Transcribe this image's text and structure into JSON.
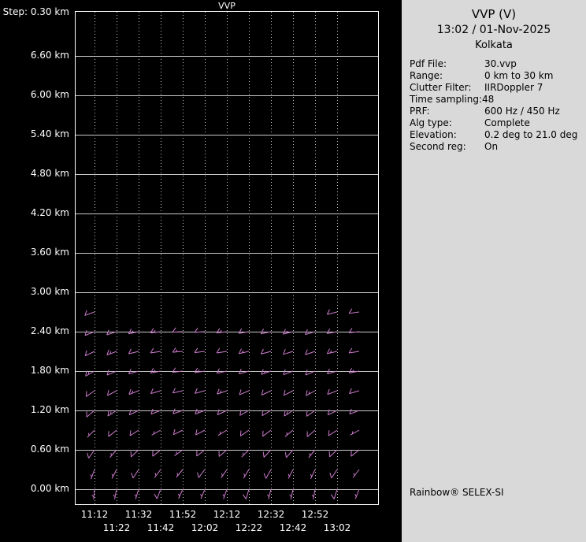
{
  "colors": {
    "background": "#000000",
    "plot_text": "#ffffff",
    "grid": "#c8c8c8",
    "border": "#ffffff",
    "barb": "#cc7ccc",
    "panel_bg": "#d9d9d9",
    "panel_text": "#000000"
  },
  "chart_data": {
    "type": "wind_barbs",
    "title": "VVP",
    "step_label": "Step: 0.30 km",
    "x_tick_labels": [
      "11:12",
      "11:22",
      "11:32",
      "11:42",
      "11:52",
      "12:02",
      "12:12",
      "12:22",
      "12:32",
      "12:42",
      "12:52",
      "13:02"
    ],
    "x_tick_interval_min": 10,
    "y_tick_km": [
      6.6,
      6.0,
      5.4,
      4.8,
      4.2,
      3.6,
      3.0,
      2.4,
      1.8,
      1.2,
      0.6,
      0.0
    ],
    "y_tick_labels": [
      "6.60 km",
      "6.00 km",
      "5.40 km",
      "4.80 km",
      "4.20 km",
      "3.60 km",
      "3.00 km",
      "2.40 km",
      "1.80 km",
      "1.20 km",
      "0.60 km",
      "0.00 km"
    ],
    "y_step_km": 0.3,
    "barbs": [
      {
        "h_km": 2.7,
        "cols": [
          0,
          11,
          12
        ],
        "dir_deg": [
          250,
          256,
          262
        ],
        "spd_kt": [
          10,
          10,
          10
        ]
      },
      {
        "h_km": 2.4,
        "cols": [
          0,
          1,
          2,
          3,
          4,
          5,
          6,
          7,
          8,
          9,
          10,
          11,
          12
        ],
        "dir_deg": [
          248,
          252,
          258,
          263,
          268,
          266,
          263,
          260,
          258,
          256,
          254,
          259,
          264
        ],
        "spd_kt": [
          10,
          10,
          15,
          15,
          10,
          10,
          15,
          10,
          10,
          15,
          10,
          10,
          10
        ]
      },
      {
        "h_km": 2.1,
        "cols": [
          0,
          1,
          2,
          3,
          4,
          5,
          6,
          7,
          8,
          9,
          10,
          11,
          12
        ],
        "dir_deg": [
          244,
          249,
          256,
          261,
          265,
          263,
          261,
          257,
          255,
          253,
          251,
          257,
          261
        ],
        "spd_kt": [
          10,
          15,
          10,
          10,
          15,
          10,
          10,
          15,
          10,
          10,
          10,
          15,
          10
        ]
      },
      {
        "h_km": 1.8,
        "cols": [
          0,
          1,
          2,
          3,
          4,
          5,
          6,
          7,
          8,
          9,
          10,
          11,
          12
        ],
        "dir_deg": [
          240,
          247,
          254,
          259,
          263,
          261,
          257,
          254,
          251,
          249,
          247,
          254,
          259
        ],
        "spd_kt": [
          15,
          10,
          10,
          15,
          10,
          15,
          10,
          10,
          15,
          10,
          10,
          10,
          15
        ]
      },
      {
        "h_km": 1.5,
        "cols": [
          0,
          1,
          2,
          3,
          4,
          5,
          6,
          7,
          8,
          9,
          10,
          11,
          12
        ],
        "dir_deg": [
          235,
          242,
          249,
          254,
          257,
          255,
          251,
          247,
          245,
          243,
          241,
          249,
          254
        ],
        "spd_kt": [
          10,
          10,
          15,
          10,
          10,
          10,
          15,
          10,
          10,
          10,
          15,
          10,
          10
        ]
      },
      {
        "h_km": 1.2,
        "cols": [
          0,
          1,
          2,
          3,
          4,
          5,
          6,
          7,
          8,
          9,
          10,
          11,
          12
        ],
        "dir_deg": [
          230,
          237,
          244,
          249,
          251,
          249,
          245,
          241,
          239,
          237,
          235,
          244,
          249
        ],
        "spd_kt": [
          10,
          15,
          10,
          10,
          10,
          15,
          10,
          10,
          10,
          15,
          10,
          10,
          10
        ]
      },
      {
        "h_km": 0.9,
        "cols": [
          0,
          1,
          2,
          3,
          4,
          5,
          6,
          7,
          8,
          9,
          10,
          11,
          12
        ],
        "dir_deg": [
          225,
          231,
          237,
          241,
          244,
          242,
          239,
          235,
          233,
          231,
          229,
          237,
          241
        ],
        "spd_kt": [
          5,
          10,
          10,
          5,
          10,
          10,
          5,
          10,
          10,
          5,
          10,
          10,
          5
        ]
      },
      {
        "h_km": 0.6,
        "cols": [
          0,
          1,
          2,
          3,
          4,
          5,
          6,
          7,
          8,
          9,
          10,
          11,
          12
        ],
        "dir_deg": [
          215,
          221,
          227,
          231,
          234,
          232,
          229,
          225,
          223,
          221,
          219,
          227,
          231
        ],
        "spd_kt": [
          10,
          5,
          10,
          10,
          5,
          10,
          10,
          5,
          10,
          10,
          5,
          10,
          10
        ]
      },
      {
        "h_km": 0.3,
        "cols": [
          0,
          1,
          2,
          3,
          4,
          5,
          6,
          7,
          8,
          9,
          10,
          11,
          12
        ],
        "dir_deg": [
          200,
          207,
          213,
          217,
          219,
          217,
          214,
          211,
          209,
          207,
          205,
          213,
          217
        ],
        "spd_kt": [
          5,
          5,
          10,
          5,
          5,
          10,
          5,
          5,
          10,
          5,
          5,
          10,
          5
        ]
      },
      {
        "h_km": 0.0,
        "cols": [
          0,
          1,
          2,
          3,
          4,
          5,
          6,
          7,
          8,
          9,
          10,
          11,
          12
        ],
        "dir_deg": [
          185,
          191,
          197,
          201,
          204,
          202,
          199,
          196,
          194,
          192,
          190,
          197,
          201
        ],
        "spd_kt": [
          5,
          5,
          5,
          10,
          5,
          5,
          5,
          10,
          5,
          5,
          5,
          10,
          5
        ]
      }
    ]
  },
  "panel": {
    "title": "VVP (V)",
    "datetime": "13:02 / 01-Nov-2025",
    "site": "Kolkata",
    "rows": [
      {
        "label": "Pdf File:",
        "value": "30.vvp"
      },
      {
        "label": "Range:",
        "value": "0 km to 30 km"
      },
      {
        "label": "Clutter Filter:",
        "value": "IIRDoppler 7"
      },
      {
        "label": "Time sampling:",
        "value": "48",
        "inline": true
      },
      {
        "label": "PRF:",
        "value": "600 Hz / 450 Hz"
      },
      {
        "label": "Alg type:",
        "value": "Complete"
      },
      {
        "label": "Elevation:",
        "value": "0.2 deg to 21.0 deg"
      },
      {
        "label": "Second reg:",
        "value": "On"
      }
    ],
    "brand": "Rainbow® SELEX-SI"
  }
}
